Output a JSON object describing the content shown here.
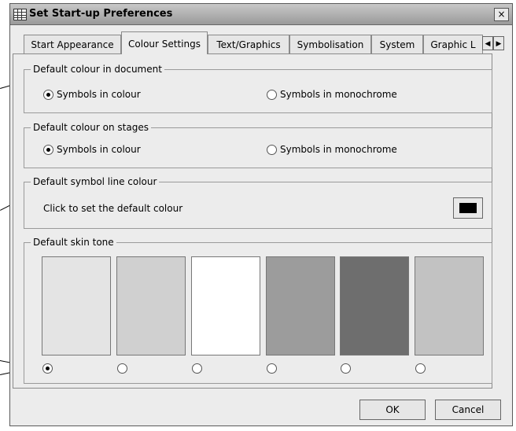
{
  "window": {
    "title": "Set Start-up Preferences",
    "close_glyph": "×"
  },
  "tabs": [
    {
      "label": "Start Appearance",
      "active": false
    },
    {
      "label": "Colour Settings",
      "active": true
    },
    {
      "label": "Text/Graphics",
      "active": false
    },
    {
      "label": "Symbolisation",
      "active": false
    },
    {
      "label": "System",
      "active": false
    },
    {
      "label": "Graphic L",
      "active": false
    }
  ],
  "tab_scroll": {
    "left_glyph": "◀",
    "right_glyph": "▶"
  },
  "groups": {
    "document_colour": {
      "legend": "Default colour in document",
      "options": [
        {
          "label": "Symbols in colour",
          "checked": true
        },
        {
          "label": "Symbols in monochrome",
          "checked": false
        }
      ]
    },
    "stages_colour": {
      "legend": "Default colour on stages",
      "options": [
        {
          "label": "Symbols in colour",
          "checked": true
        },
        {
          "label": "Symbols in monochrome",
          "checked": false
        }
      ]
    },
    "line_colour": {
      "legend": "Default symbol line colour",
      "text": "Click to set the default colour",
      "current_colour": "#000000"
    },
    "skin_tone": {
      "legend": "Default skin tone",
      "tones": [
        {
          "colour": "#e4e4e4",
          "checked": true
        },
        {
          "colour": "#d0d0d0",
          "checked": false
        },
        {
          "colour": "#ffffff",
          "checked": false
        },
        {
          "colour": "#9c9c9c",
          "checked": false
        },
        {
          "colour": "#6e6e6e",
          "checked": false
        },
        {
          "colour": "#c2c2c2",
          "checked": false
        }
      ]
    }
  },
  "buttons": {
    "ok": "OK",
    "cancel": "Cancel"
  }
}
